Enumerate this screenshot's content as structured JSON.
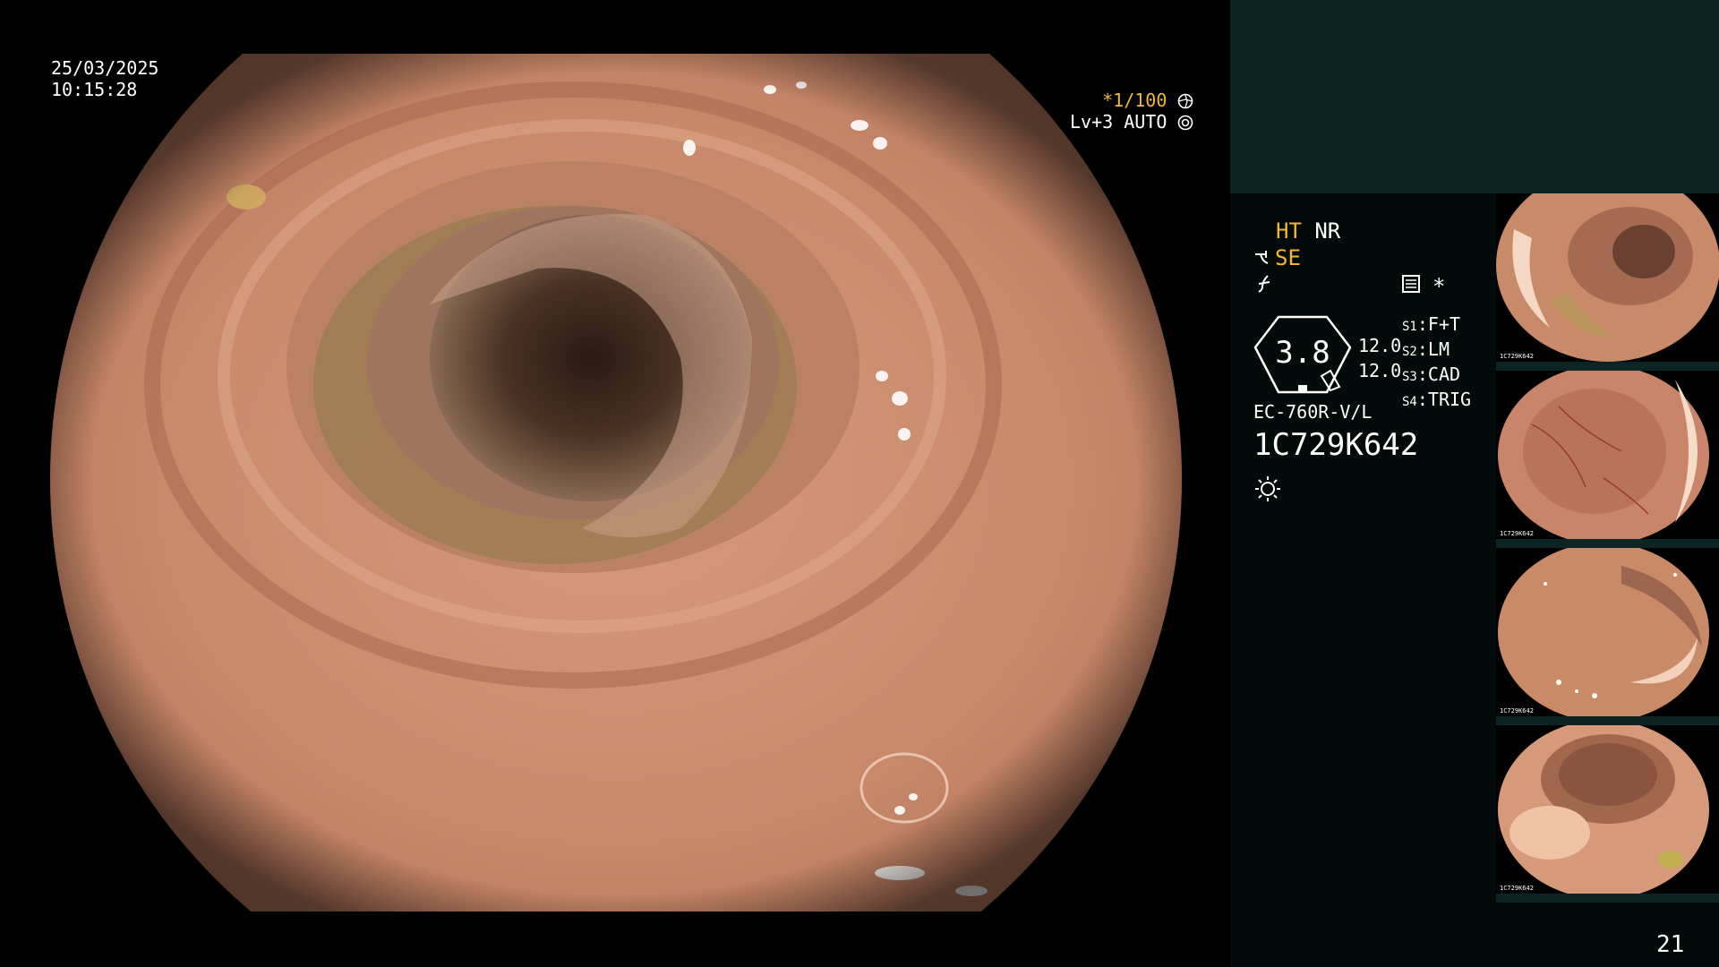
{
  "overlay": {
    "date": "25/03/2025",
    "time": "10:15:28",
    "shutter": "*1/100",
    "level": "Lv+3",
    "iris": "AUTO"
  },
  "panel": {
    "ht": "HT",
    "nr": "NR",
    "se": "SE",
    "star": "*",
    "gauge_value": "3.8",
    "values": [
      "12.0",
      "12.0"
    ],
    "switches": [
      {
        "key": "S1",
        "value": "F+T"
      },
      {
        "key": "S2",
        "value": "LM"
      },
      {
        "key": "S3",
        "value": "CAD"
      },
      {
        "key": "S4",
        "value": "TRIG"
      }
    ],
    "scope_model": "EC-760R-V/L",
    "scope_serial": "1C729K642",
    "page_number": "21"
  },
  "thumbnails": [
    {
      "serial": "1C729K642",
      "index": "20"
    },
    {
      "serial": "1C729K642",
      "index": "19"
    },
    {
      "serial": "1C729K642",
      "index": "18"
    },
    {
      "serial": "1C729K642",
      "index": "17"
    }
  ],
  "colors": {
    "amber": "#f2b632",
    "panel_bg": "#020a0a",
    "panel_top_bg": "#0d2424",
    "mucosa": "#c98a6c"
  },
  "icons": [
    "shutter-icon",
    "iris-icon",
    "pump-icon",
    "cut-icon",
    "menu-icon",
    "light-icon"
  ]
}
